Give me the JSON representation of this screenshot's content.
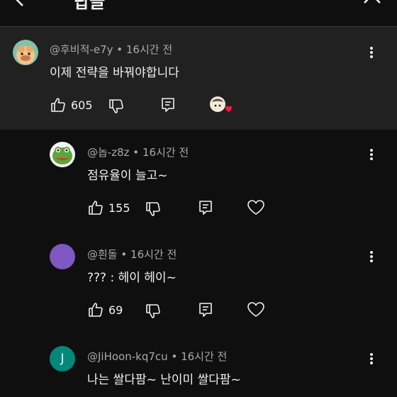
{
  "header": {
    "title": "답글"
  },
  "main_comment": {
    "author": "@후비적-e7y",
    "time": "16시간 전",
    "text": "이제 전략을 바꿔야합니다",
    "likes": "605"
  },
  "replies": [
    {
      "author": "@놉-z8z",
      "time": "16시간 전",
      "text": "점유율이 늘고~",
      "likes": "155",
      "avatar_color": "#6aa84f"
    },
    {
      "author": "@흰돌",
      "time": "16시간 전",
      "text": "??? : 헤이 헤이~",
      "likes": "69",
      "avatar_color": "#7e57c2"
    },
    {
      "author": "@JiHoon-kq7cu",
      "time": "16시간 전",
      "text": "나는 쌀다팜~ 난이미 쌀다팜~",
      "avatar_letter": "J",
      "avatar_color": "#00897b"
    }
  ],
  "separator": "•",
  "icons": {
    "back": "back-arrow-icon",
    "close": "close-icon",
    "more": "more-vert-icon",
    "like": "thumb-up-icon",
    "dislike": "thumb-down-icon",
    "reply": "reply-icon",
    "heart": "heart-icon",
    "creator_heart": "creator-heart-badge"
  }
}
